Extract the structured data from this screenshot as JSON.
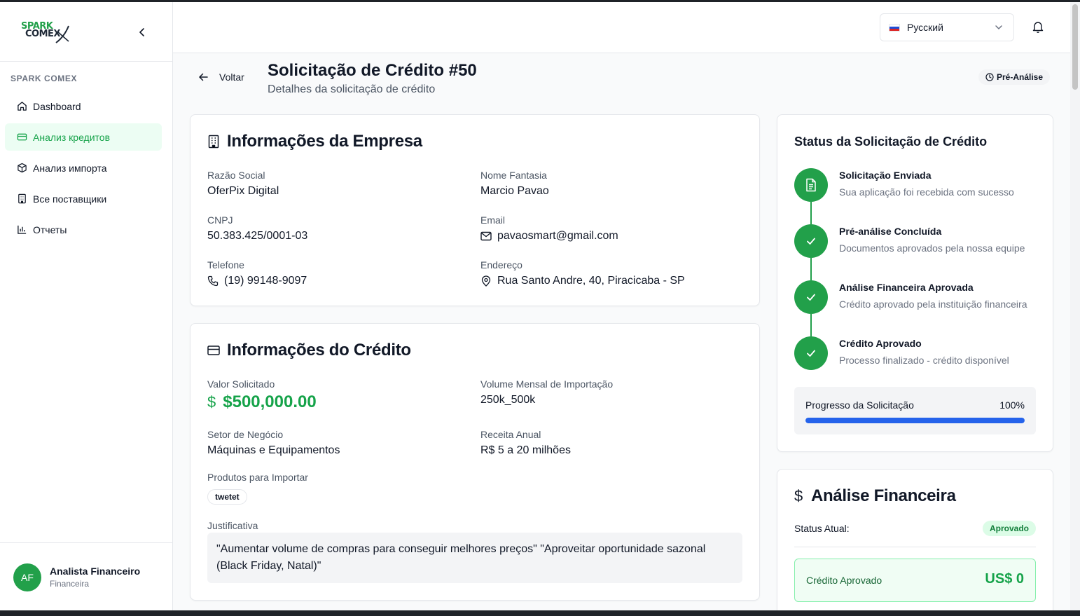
{
  "brand": {
    "logo_line1": "SPARK",
    "logo_line2": "COMEX",
    "section_label": "SPARK COMEX",
    "accent_color": "#22a04a"
  },
  "sidebar": {
    "items": [
      {
        "label": "Dashboard",
        "icon": "home-icon",
        "active": false
      },
      {
        "label": "Анализ кредитов",
        "icon": "credit-card-icon",
        "active": true
      },
      {
        "label": "Анализ импорта",
        "icon": "package-icon",
        "active": false
      },
      {
        "label": "Все поставщики",
        "icon": "building-icon",
        "active": false
      },
      {
        "label": "Отчеты",
        "icon": "bar-chart-icon",
        "active": false
      }
    ],
    "user": {
      "initials": "AF",
      "name": "Analista Financeiro",
      "role": "Financeira"
    }
  },
  "header": {
    "language": "Русский"
  },
  "page": {
    "back_label": "Voltar",
    "title": "Solicitação de Crédito #50",
    "subtitle": "Detalhes da solicitação de crédito",
    "status": "Pré-Análise"
  },
  "company": {
    "title": "Informações da Empresa",
    "razao_label": "Razão Social",
    "razao_value": "OferPix Digital",
    "fantasia_label": "Nome Fantasia",
    "fantasia_value": "Marcio Pavao",
    "cnpj_label": "CNPJ",
    "cnpj_value": "50.383.425/0001-03",
    "email_label": "Email",
    "email_value": "pavaosmart@gmail.com",
    "telefone_label": "Telefone",
    "telefone_value": "(19) 99148-9097",
    "endereco_label": "Endereço",
    "endereco_value": "Rua Santo Andre, 40, Piracicaba - SP"
  },
  "credit": {
    "title": "Informações do Crédito",
    "valor_label": "Valor Solicitado",
    "valor_symbol": "$",
    "valor_value": "$500,000.00",
    "volume_label": "Volume Mensal de Importação",
    "volume_value": "250k_500k",
    "setor_label": "Setor de Negócio",
    "setor_value": "Máquinas e Equipamentos",
    "receita_label": "Receita Anual",
    "receita_value": "R$ 5 a 20 milhões",
    "produtos_label": "Produtos para Importar",
    "produtos": [
      "twetet"
    ],
    "justificativa_label": "Justificativa",
    "justificativa_value": "\"Aumentar volume de compras para conseguir melhores preços\" \"Aproveitar oportunidade sazonal (Black Friday, Natal)\""
  },
  "status_card": {
    "title": "Status da Solicitação de Crédito",
    "steps": [
      {
        "title": "Solicitação Enviada",
        "desc": "Sua aplicação foi recebida com sucesso",
        "icon": "file-text-icon"
      },
      {
        "title": "Pré-análise Concluída",
        "desc": "Documentos aprovados pela nossa equipe",
        "icon": "check-icon"
      },
      {
        "title": "Análise Financeira Aprovada",
        "desc": "Crédito aprovado pela instituição financeira",
        "icon": "check-icon"
      },
      {
        "title": "Crédito Aprovado",
        "desc": "Processo finalizado - crédito disponível",
        "icon": "check-icon"
      }
    ],
    "progress_label": "Progresso da Solicitação",
    "progress_text": "100%",
    "progress_value": 1.0
  },
  "financial": {
    "title": "Análise Financeira",
    "status_label": "Status Atual:",
    "status_value": "Aprovado",
    "credit_label": "Crédito Aprovado",
    "credit_value": "US$ 0"
  }
}
